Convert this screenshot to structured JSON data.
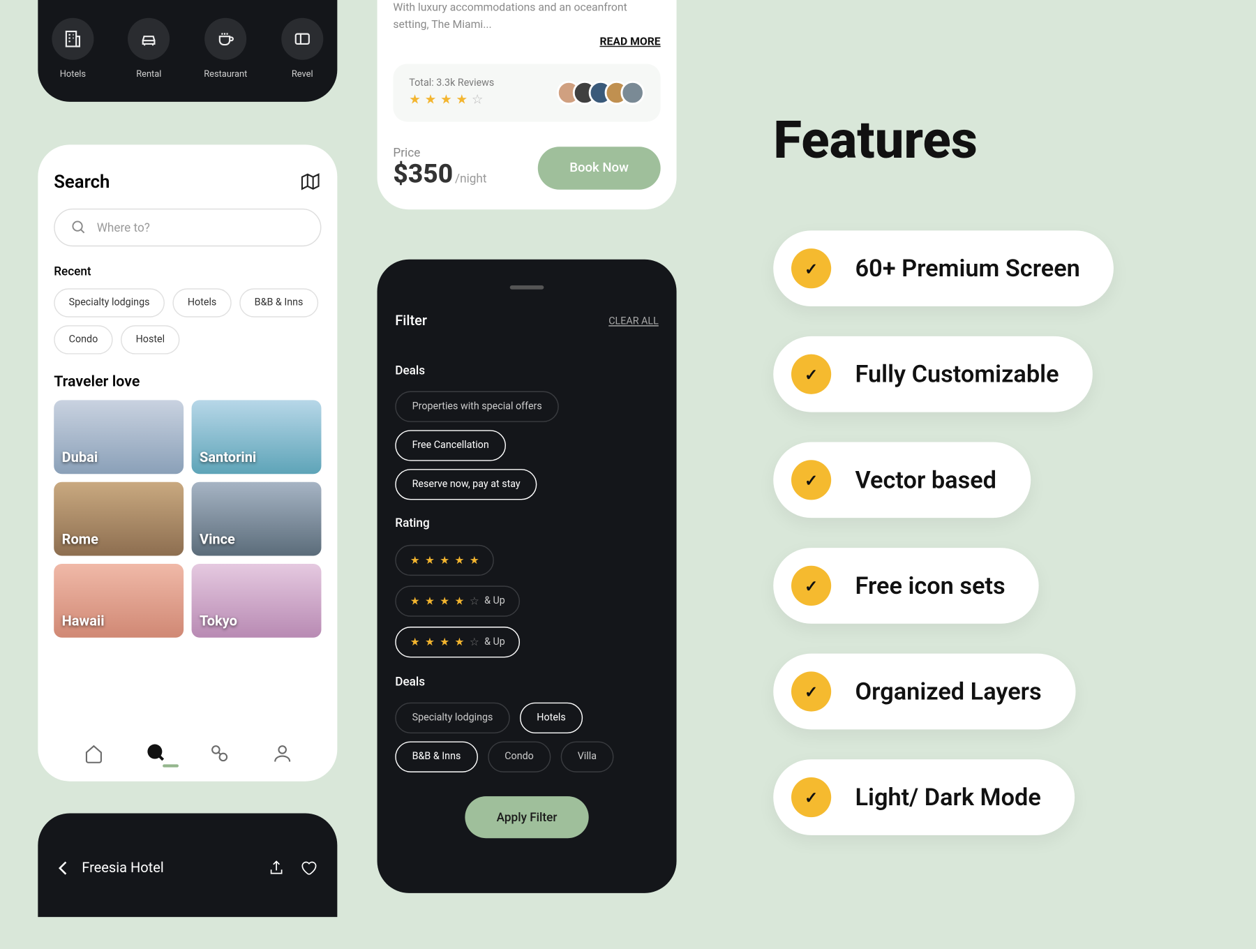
{
  "categories": [
    {
      "label": "Hotels"
    },
    {
      "label": "Rental"
    },
    {
      "label": "Restaurant"
    },
    {
      "label": "Revel"
    }
  ],
  "search": {
    "title": "Search",
    "placeholder": "Where to?",
    "recent_label": "Recent",
    "recent": [
      "Specialty lodgings",
      "Hotels",
      "B&B & Inns",
      "Condo",
      "Hostel"
    ],
    "traveler_label": "Traveler love",
    "destinations": [
      "Dubai",
      "Santorini",
      "Rome",
      "Vince",
      "Hawaii",
      "Tokyo"
    ]
  },
  "detail_header": {
    "title": "Freesia Hotel"
  },
  "hotel": {
    "desc": "With luxury accommodations and an oceanfront setting, The Miami...",
    "readmore": "READ MORE",
    "reviews": "Total: 3.3k Reviews",
    "price_label": "Price",
    "price": "$350",
    "per": "/night",
    "book": "Book Now"
  },
  "filter": {
    "title": "Filter",
    "clear": "CLEAR ALL",
    "deals_label": "Deals",
    "deals": [
      {
        "label": "Properties with special offers",
        "sel": false
      },
      {
        "label": "Free Cancellation",
        "sel": true
      },
      {
        "label": "Reserve now, pay at stay",
        "sel": true
      }
    ],
    "rating_label": "Rating",
    "and_up": "& Up",
    "types_label": "Deals",
    "types": [
      {
        "label": "Specialty lodgings",
        "sel": false
      },
      {
        "label": "Hotels",
        "sel": true
      },
      {
        "label": "B&B & Inns",
        "sel": true
      },
      {
        "label": "Condo",
        "sel": false
      },
      {
        "label": "Villa",
        "sel": false
      }
    ],
    "apply": "Apply Filter"
  },
  "features": {
    "title": "Features",
    "items": [
      "60+ Premium Screen",
      "Fully Customizable",
      "Vector based",
      "Free icon sets",
      "Organized Layers",
      "Light/ Dark Mode"
    ]
  }
}
